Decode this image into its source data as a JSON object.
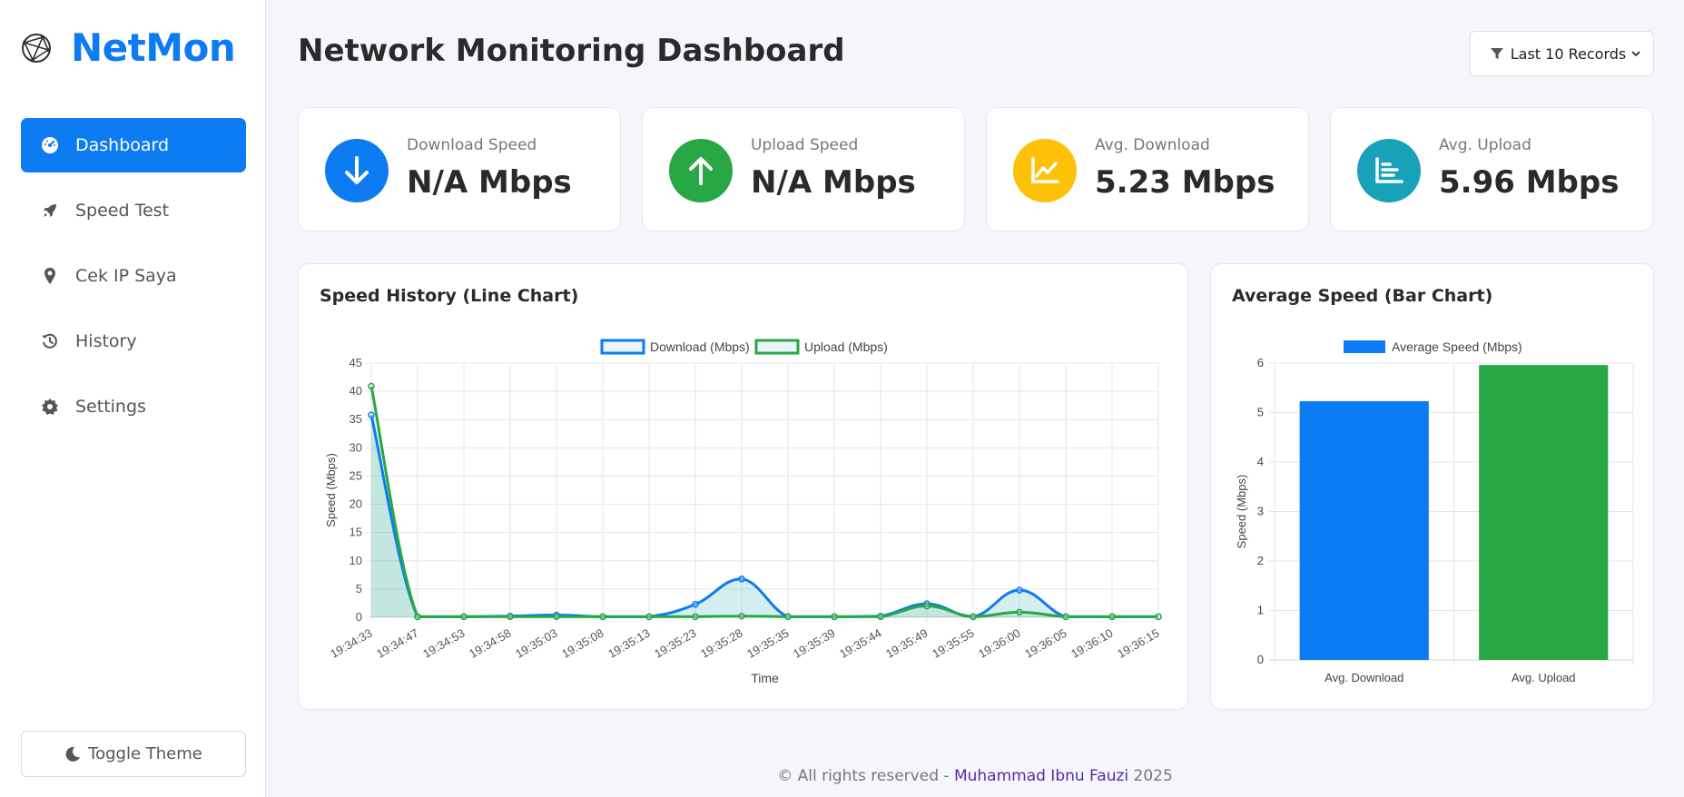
{
  "app": {
    "brand": "NetMon",
    "title": "Network Monitoring Dashboard",
    "accent_color": "#0d7bf2"
  },
  "sidebar": {
    "items": [
      {
        "label": "Dashboard",
        "icon": "speedometer-icon",
        "active": true
      },
      {
        "label": "Speed Test",
        "icon": "rocket-icon",
        "active": false
      },
      {
        "label": "Cek IP Saya",
        "icon": "map-pin-icon",
        "active": false
      },
      {
        "label": "History",
        "icon": "history-icon",
        "active": false
      },
      {
        "label": "Settings",
        "icon": "gear-icon",
        "active": false
      }
    ],
    "toggle_theme": "Toggle Theme"
  },
  "filter": {
    "label": "Last 10 Records"
  },
  "cards": [
    {
      "label": "Download Speed",
      "value": "N/A Mbps",
      "icon": "arrow-down-icon",
      "color": "#0d7bf2"
    },
    {
      "label": "Upload Speed",
      "value": "N/A Mbps",
      "icon": "arrow-up-icon",
      "color": "#28a745"
    },
    {
      "label": "Avg. Download",
      "value": "5.23 Mbps",
      "icon": "line-chart-icon",
      "color": "#ffc107"
    },
    {
      "label": "Avg. Upload",
      "value": "5.96 Mbps",
      "icon": "bar-chart-icon",
      "color": "#17a2b8"
    }
  ],
  "footer": {
    "prefix": "© All rights reserved - ",
    "author": "Muhammad Ibnu Fauzi",
    "year": " 2025"
  },
  "chart_data": [
    {
      "type": "line",
      "title": "Speed History (Line Chart)",
      "xlabel": "Time",
      "ylabel": "Speed (Mbps)",
      "ylim": [
        0,
        45
      ],
      "yticks": [
        0,
        5,
        10,
        15,
        20,
        25,
        30,
        35,
        40,
        45
      ],
      "grid": true,
      "legend": "top",
      "x": [
        "19:34:33",
        "19:34:47",
        "19:34:53",
        "19:34:58",
        "19:35:03",
        "19:35:08",
        "19:35:13",
        "19:35:23",
        "19:35:28",
        "19:35:35",
        "19:35:39",
        "19:35:44",
        "19:35:49",
        "19:35:55",
        "19:36:00",
        "19:36:05",
        "19:36:10",
        "19:36:15"
      ],
      "series": [
        {
          "name": "Download (Mbps)",
          "color": "#0d7bf2",
          "fill": "rgba(23,162,184,0.18)",
          "values": [
            35.8,
            0.1,
            0.1,
            0.2,
            0.4,
            0.1,
            0.1,
            2.3,
            6.8,
            0.1,
            0.1,
            0.2,
            2.4,
            0.1,
            4.8,
            0.1,
            0.1,
            0.1
          ]
        },
        {
          "name": "Upload (Mbps)",
          "color": "#28a745",
          "fill": "rgba(40,167,69,0.10)",
          "values": [
            40.9,
            0.1,
            0.1,
            0.1,
            0.1,
            0.1,
            0.1,
            0.1,
            0.2,
            0.1,
            0.1,
            0.1,
            2.0,
            0.1,
            0.9,
            0.1,
            0.1,
            0.1
          ]
        }
      ]
    },
    {
      "type": "bar",
      "title": "Average Speed (Bar Chart)",
      "ylabel": "Speed (Mbps)",
      "ylim": [
        0,
        6
      ],
      "yticks": [
        0,
        1,
        2,
        3,
        4,
        5,
        6
      ],
      "grid": true,
      "legend": "top",
      "categories": [
        "Avg. Download",
        "Avg. Upload"
      ],
      "series": [
        {
          "name": "Average Speed (Mbps)",
          "values": [
            5.23,
            5.96
          ],
          "colors": [
            "#0d7bf2",
            "#28a745"
          ]
        }
      ]
    }
  ]
}
